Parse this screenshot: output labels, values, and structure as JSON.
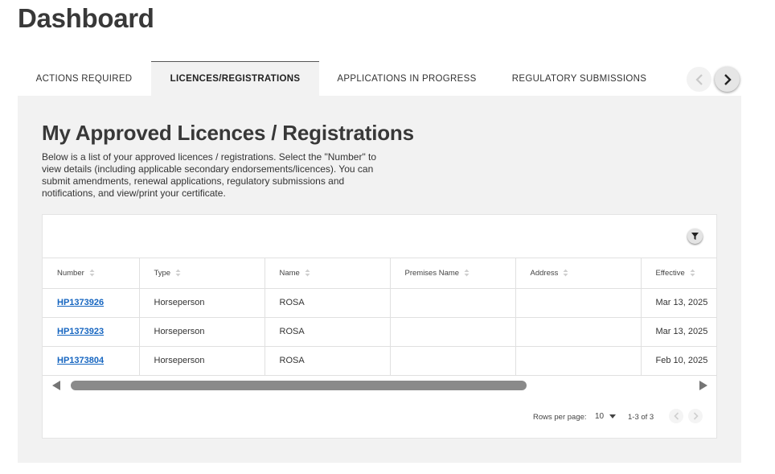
{
  "page_title": "Dashboard",
  "tabs": [
    {
      "label": "ACTIONS REQUIRED",
      "active": false
    },
    {
      "label": "LICENCES/REGISTRATIONS",
      "active": true
    },
    {
      "label": "APPLICATIONS IN PROGRESS",
      "active": false
    },
    {
      "label": "REGULATORY SUBMISSIONS",
      "active": false
    }
  ],
  "tab_nav": {
    "prev_icon": "chevron-left-icon",
    "next_icon": "chevron-right-icon"
  },
  "section": {
    "title": "My Approved Licences / Registrations",
    "description": "Below is a list of your approved licences / registrations. Select the \"Number\" to view details (including applicable secondary endorsements/licences). You can submit amendments, renewal applications, regulatory submissions and notifications, and view/print your certificate."
  },
  "table": {
    "filter_icon": "filter-icon",
    "columns": [
      "Number",
      "Type",
      "Name",
      "Premises Name",
      "Address",
      "Effective"
    ],
    "rows": [
      {
        "number": "HP1373926",
        "type": "Horseperson",
        "name": "ROSA",
        "premises_name": "",
        "address": "",
        "effective": "Mar 13, 2025"
      },
      {
        "number": "HP1373923",
        "type": "Horseperson",
        "name": "ROSA",
        "premises_name": "",
        "address": "",
        "effective": "Mar 13, 2025"
      },
      {
        "number": "HP1373804",
        "type": "Horseperson",
        "name": "ROSA",
        "premises_name": "",
        "address": "",
        "effective": "Feb 10, 2025"
      }
    ]
  },
  "pagination": {
    "rows_per_page_label": "Rows per page:",
    "rows_per_page_value": "10",
    "range": "1-3 of 3"
  },
  "colors": {
    "link": "#1565c0",
    "panel_bg": "#f2f2f2",
    "heading": "#383838"
  }
}
